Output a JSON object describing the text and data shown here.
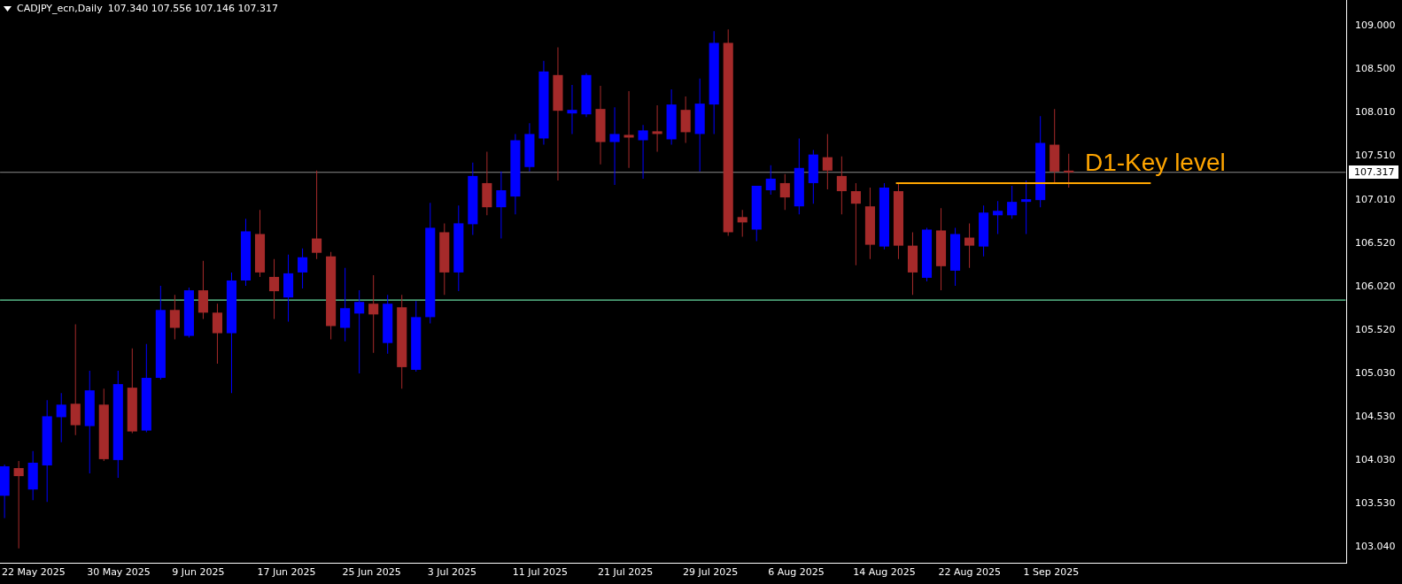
{
  "chart": {
    "symbol": "CADJPY_ecn,Daily",
    "ohlc": "107.340 107.556 107.146 107.317",
    "price_ticks": [
      "109.000",
      "108.500",
      "108.010",
      "107.510",
      "107.010",
      "106.520",
      "106.020",
      "105.520",
      "105.030",
      "104.530",
      "104.030",
      "103.530",
      "103.040"
    ],
    "current_price": "107.317",
    "dates": [
      "22 May 2025",
      "30 May 2025",
      "9 Jun 2025",
      "17 Jun 2025",
      "25 Jun 2025",
      "3 Jul 2025",
      "11 Jul 2025",
      "21 Jul 2025",
      "29 Jul 2025",
      "6 Aug 2025",
      "14 Aug 2025",
      "22 Aug 2025",
      "1 Sep 2025"
    ],
    "annotation": "D1-Key level"
  }
}
